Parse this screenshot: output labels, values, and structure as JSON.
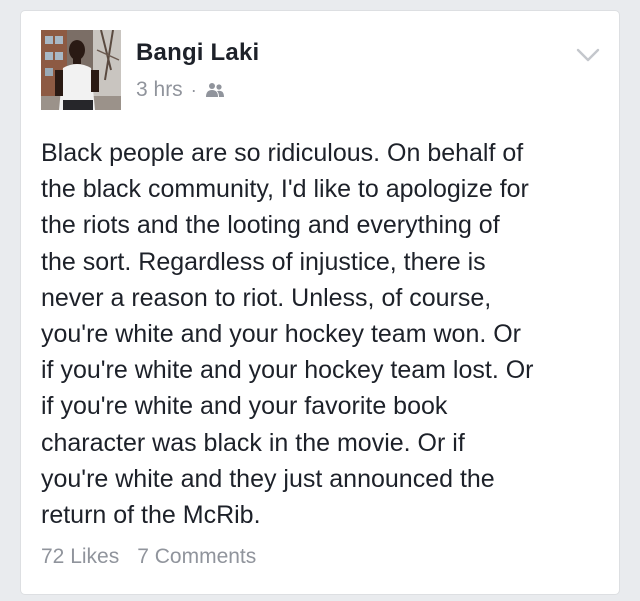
{
  "post": {
    "author": "Bangi Laki",
    "time": "3 hrs",
    "separator": "·",
    "audience_icon": "friends-icon",
    "menu_icon": "chevron-down-icon",
    "text": "Black people are so ridiculous. On behalf of\nthe black community, I'd like to apologize for\nthe riots and the looting and everything of\nthe sort. Regardless of injustice, there is\nnever a reason to riot. Unless, of course,\nyou're white and your hockey team won. Or\nif you're white and your hockey team lost. Or\nif you're white and your favorite book\ncharacter was black in the movie. Or if\nyou're white and they just announced the\nreturn of the McRib.",
    "likes": "72 Likes",
    "comments": "7 Comments"
  },
  "colors": {
    "card_bg": "#ffffff",
    "page_bg": "#e9ebee",
    "text": "#1d2129",
    "secondary": "#90949c"
  }
}
